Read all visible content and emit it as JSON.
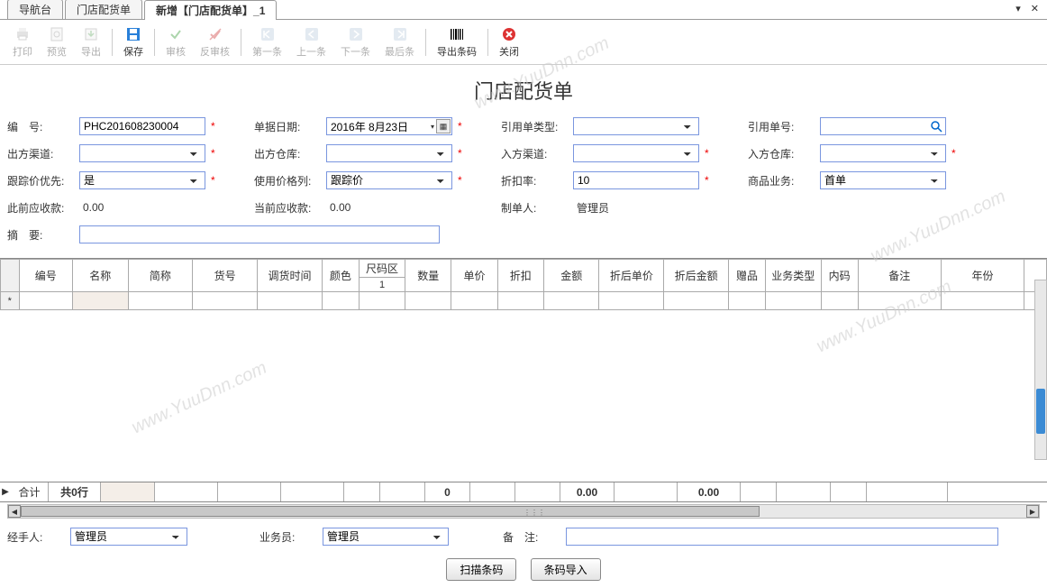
{
  "tabs": {
    "items": [
      "导航台",
      "门店配货单",
      "新增【门店配货单】_1"
    ],
    "active_index": 2
  },
  "toolbar": {
    "print": "打印",
    "preview": "预览",
    "export": "导出",
    "save": "保存",
    "audit": "审核",
    "unaudit": "反审核",
    "first": "第一条",
    "prev": "上一条",
    "next": "下一条",
    "last": "最后条",
    "export_barcode": "导出条码",
    "close": "关闭"
  },
  "title": "门店配货单",
  "form": {
    "code_lbl": "编　号:",
    "code_val": "PHC201608230004",
    "date_lbl": "单据日期:",
    "date_val": "2016年 8月23日",
    "ref_type_lbl": "引用单类型:",
    "ref_type_val": "",
    "ref_no_lbl": "引用单号:",
    "ref_no_val": "",
    "out_channel_lbl": "出方渠道:",
    "out_channel_val": "",
    "out_wh_lbl": "出方仓库:",
    "out_wh_val": "",
    "in_channel_lbl": "入方渠道:",
    "in_channel_val": "",
    "in_wh_lbl": "入方仓库:",
    "in_wh_val": "",
    "track_lbl": "跟踪价优先:",
    "track_val": "是",
    "price_col_lbl": "使用价格列:",
    "price_col_val": "跟踪价",
    "discount_lbl": "折扣率:",
    "discount_val": "10",
    "biz_lbl": "商品业务:",
    "biz_val": "首单",
    "prev_recv_lbl": "此前应收款:",
    "prev_recv_val": "0.00",
    "curr_recv_lbl": "当前应收款:",
    "curr_recv_val": "0.00",
    "creator_lbl": "制单人:",
    "creator_val": "管理员",
    "summary_lbl": "摘　要:",
    "summary_val": ""
  },
  "grid": {
    "headers": {
      "no": "编号",
      "name": "名称",
      "short": "简称",
      "sku": "货号",
      "transfer_time": "调货时间",
      "color": "颜色",
      "size_zone": "尺码区",
      "size_sub": "1",
      "qty": "数量",
      "price": "单价",
      "discount": "折扣",
      "amount": "金额",
      "after_price": "折后单价",
      "after_amount": "折后金额",
      "gift": "赠品",
      "biz_type": "业务类型",
      "inner_code": "内码",
      "remark": "备注",
      "year": "年份"
    },
    "row_marker": "*"
  },
  "totals": {
    "label": "合计",
    "rows_text": "共0行",
    "qty": "0",
    "amount": "0.00",
    "after_amount": "0.00"
  },
  "footer_form": {
    "handler_lbl": "经手人:",
    "handler_val": "管理员",
    "sales_lbl": "业务员:",
    "sales_val": "管理员",
    "remark_lbl": "备　注:",
    "remark_val": ""
  },
  "footer_btns": {
    "scan": "扫描条码",
    "import": "条码导入"
  },
  "watermark": "www.YuuDnn.com"
}
